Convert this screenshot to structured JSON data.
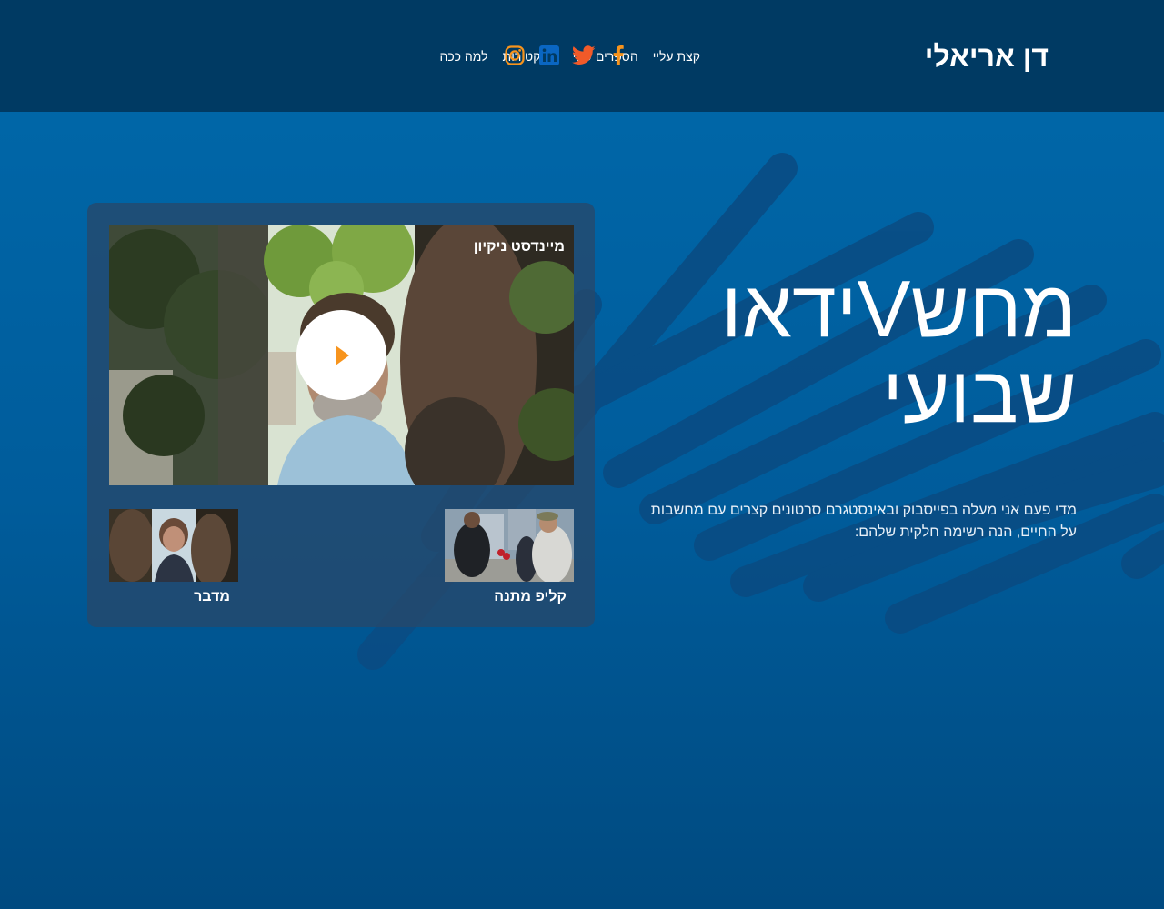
{
  "header": {
    "logo": "דן אריאלי",
    "nav": [
      {
        "label": "קצת עליי"
      },
      {
        "label": "הספרים שלי"
      },
      {
        "label": "קריקטורות"
      },
      {
        "label": "למה ככה"
      }
    ],
    "social": [
      {
        "icon": "facebook-icon",
        "color": "#f7941d"
      },
      {
        "icon": "twitter-icon",
        "color": "#f15a29"
      },
      {
        "icon": "linkedin-icon",
        "color": "#0a66c2"
      },
      {
        "icon": "instagram-icon",
        "color": "#f7941d"
      }
    ]
  },
  "hero": {
    "title_line1": "מחשVידאו",
    "title_line2": "שבועי",
    "description": "מדי פעם אני מעלה בפייסבוק ובאינסטגרם סרטונים קצרים עם מחשבות על החיים, הנה רשימה חלקית שלהם:"
  },
  "videos": {
    "main": {
      "title": "מיינדסט ניקיון",
      "play_icon": "play-icon",
      "play_color": "#f7941d"
    },
    "thumbnails": [
      {
        "title": "קליפ מתנה"
      },
      {
        "title": "מדבר"
      }
    ]
  },
  "colors": {
    "header_bg": "#003a63",
    "page_bg": "#0069ab",
    "accent": "#f7941d"
  }
}
